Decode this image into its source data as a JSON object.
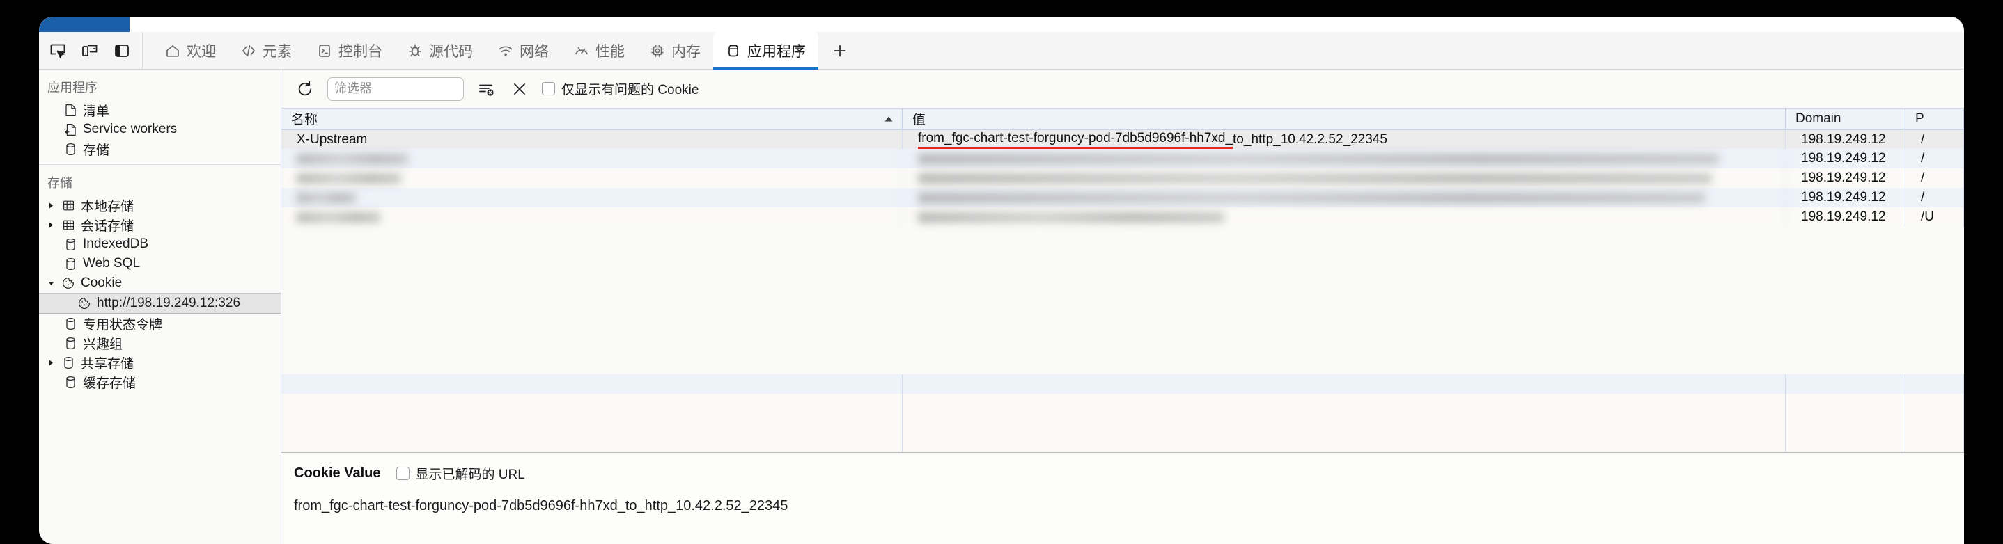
{
  "window": {
    "accent_color": "#1a5fa8",
    "tab_active_underline": "#1a73c8"
  },
  "toolbar": {
    "icons": [
      {
        "name": "inspect-element-icon",
        "label": "检查元素"
      },
      {
        "name": "device-toolbar-icon",
        "label": "设备模拟"
      },
      {
        "name": "dock-layout-icon",
        "label": "停靠位置"
      }
    ]
  },
  "tabs": [
    {
      "label": "欢迎",
      "icon": "home-icon",
      "active": false
    },
    {
      "label": "元素",
      "icon": "code-brackets-icon",
      "active": false
    },
    {
      "label": "控制台",
      "icon": "terminal-icon",
      "active": false
    },
    {
      "label": "源代码",
      "icon": "bug-icon",
      "active": false
    },
    {
      "label": "网络",
      "icon": "wifi-icon",
      "active": false
    },
    {
      "label": "性能",
      "icon": "gauge-icon",
      "active": false
    },
    {
      "label": "内存",
      "icon": "chip-icon",
      "active": false
    },
    {
      "label": "应用程序",
      "icon": "app-storage-icon",
      "active": true
    }
  ],
  "add_tab_label": "+",
  "sidebar": {
    "sections": [
      {
        "title": "应用程序",
        "items": [
          {
            "label": "清单",
            "icon": "document-icon",
            "disclosure": "none",
            "indent": 1,
            "selected": false
          },
          {
            "label": "Service workers",
            "icon": "document-gear-icon",
            "disclosure": "none",
            "indent": 1,
            "selected": false
          },
          {
            "label": "存储",
            "icon": "database-icon",
            "disclosure": "none",
            "indent": 1,
            "selected": false
          }
        ]
      },
      {
        "title": "存储",
        "items": [
          {
            "label": "本地存储",
            "icon": "table-grid-icon",
            "disclosure": "collapsed",
            "indent": 0,
            "selected": false
          },
          {
            "label": "会话存储",
            "icon": "table-grid-icon",
            "disclosure": "collapsed",
            "indent": 0,
            "selected": false
          },
          {
            "label": "IndexedDB",
            "icon": "database-icon",
            "disclosure": "none",
            "indent": 1,
            "selected": false
          },
          {
            "label": "Web SQL",
            "icon": "database-icon",
            "disclosure": "none",
            "indent": 1,
            "selected": false
          },
          {
            "label": "Cookie",
            "icon": "cookie-icon",
            "disclosure": "expanded",
            "indent": 0,
            "selected": false
          },
          {
            "label": "http://198.19.249.12:326",
            "icon": "cookie-icon",
            "disclosure": "none",
            "indent": 2,
            "selected": true
          },
          {
            "label": "专用状态令牌",
            "icon": "database-icon",
            "disclosure": "none",
            "indent": 1,
            "selected": false
          },
          {
            "label": "兴趣组",
            "icon": "database-icon",
            "disclosure": "none",
            "indent": 1,
            "selected": false
          },
          {
            "label": "共享存储",
            "icon": "database-icon",
            "disclosure": "collapsed",
            "indent": 0,
            "selected": false
          },
          {
            "label": "缓存存储",
            "icon": "database-icon",
            "disclosure": "none",
            "indent": 1,
            "selected": false
          }
        ]
      }
    ]
  },
  "filterbar": {
    "refresh_label": "刷新",
    "filter_placeholder": "筛选器",
    "filter_value": "",
    "clear_filter_label": "清除筛选",
    "delete_label": "删除",
    "issues_only_label": "仅显示有问题的 Cookie",
    "issues_only_checked": false
  },
  "table": {
    "columns": [
      {
        "key": "name",
        "label": "名称",
        "sort": "asc"
      },
      {
        "key": "value",
        "label": "值",
        "sort": "none"
      },
      {
        "key": "domain",
        "label": "Domain",
        "sort": "none"
      },
      {
        "key": "path",
        "label": "P",
        "sort": "none"
      }
    ],
    "rows": [
      {
        "name": "X-Upstream",
        "value": "from_fgc-chart-test-forguncy-pod-7db5d9696f-hh7xd_to_http_10.42.2.52_22345",
        "value_underlined": "from_fgc-chart-test-forguncy-pod-7db5d9696f-hh7xd_",
        "domain": "198.19.249.12",
        "path": "/",
        "selected": true,
        "redacted": false
      },
      {
        "name": "",
        "value": "",
        "domain": "198.19.249.12",
        "path": "/",
        "selected": false,
        "redacted": true
      },
      {
        "name": "",
        "value": "",
        "domain": "198.19.249.12",
        "path": "/",
        "selected": false,
        "redacted": true
      },
      {
        "name": "",
        "value": "",
        "domain": "198.19.249.12",
        "path": "/",
        "selected": false,
        "redacted": true
      },
      {
        "name": "",
        "value": "",
        "domain": "198.19.249.12",
        "path": "/U",
        "selected": false,
        "redacted": true
      }
    ]
  },
  "detail": {
    "title": "Cookie Value",
    "decoded_url_label": "显示已解码的 URL",
    "decoded_url_checked": false,
    "value": "from_fgc-chart-test-forguncy-pod-7db5d9696f-hh7xd_to_http_10.42.2.52_22345"
  }
}
